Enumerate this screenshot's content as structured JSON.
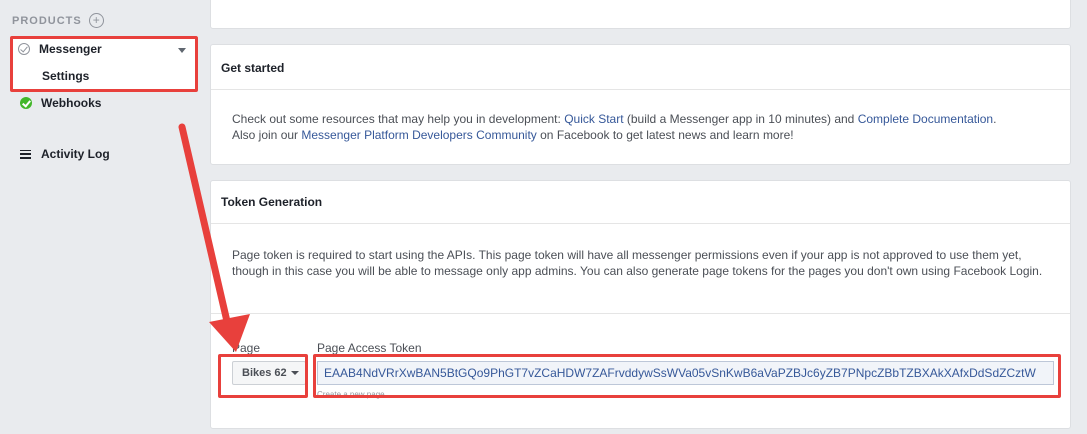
{
  "sidebar": {
    "products_header": "PRODUCTS",
    "plus_symbol": "+",
    "items": [
      {
        "label": "Messenger",
        "status": "outline-check"
      },
      {
        "label": "Settings"
      },
      {
        "label": "Webhooks",
        "status": "green-check"
      },
      {
        "label": "Activity Log"
      }
    ]
  },
  "get_started": {
    "title": "Get started",
    "line1_pre": "Check out some resources that may help you in development: ",
    "quick_start": "Quick Start",
    "line1_mid": " (build a Messenger app in 10 minutes) and ",
    "complete_docs": "Complete Documentation",
    "line1_end": ".",
    "line2_pre": "Also join our ",
    "community": "Messenger Platform Developers Community",
    "line2_end": " on Facebook to get latest news and learn more!"
  },
  "token_generation": {
    "title": "Token Generation",
    "description": "Page token is required to start using the APIs. This page token will have all messenger permissions even if your app is not approved to use them yet, though in this case you will be able to message only app admins. You can also generate page tokens for the pages you don't own using Facebook Login.",
    "page_label": "Page",
    "page_selected": "Bikes 62",
    "token_label": "Page Access Token",
    "token_value": "EAAB4NdVRrXwBAN5BtGQo9PhGT7vZCaHDW7ZAFrvddywSsWVa05vSnKwB6aVaPZBJc6yZB7PNpcZBbTZBXAkXAfxDdSdZCztW",
    "create_link": "Create a new page"
  },
  "colors": {
    "annotation_red": "#e8403c",
    "link_blue": "#365899",
    "success_green": "#42b72a"
  }
}
